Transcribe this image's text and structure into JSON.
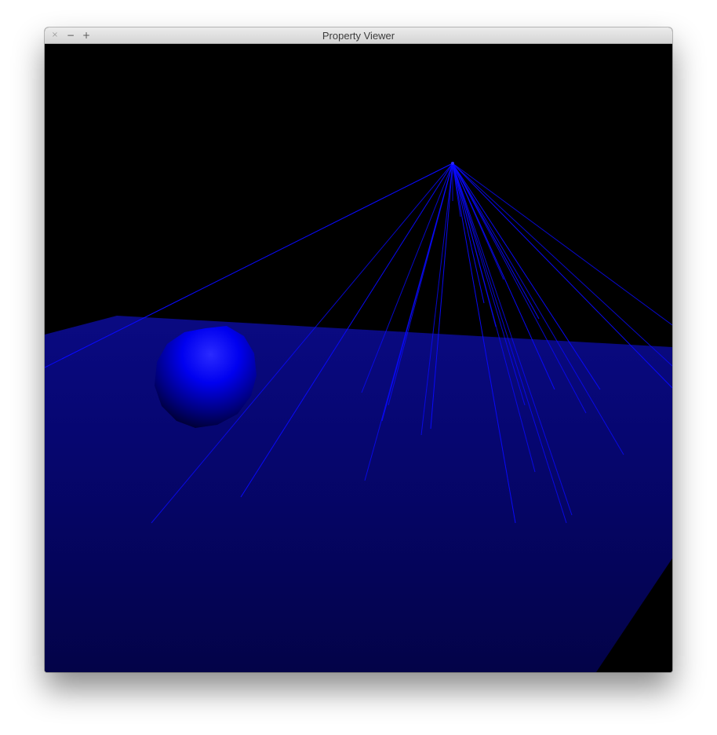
{
  "window": {
    "title": "Property Viewer",
    "controls": {
      "close_icon": "×",
      "minimize_icon": "−",
      "zoom_icon": "+"
    }
  },
  "scene": {
    "background_color": "#000000",
    "plane_color": "#00005a",
    "ray_color": "#0a0aff",
    "sphere_color": "#0b0bff"
  }
}
